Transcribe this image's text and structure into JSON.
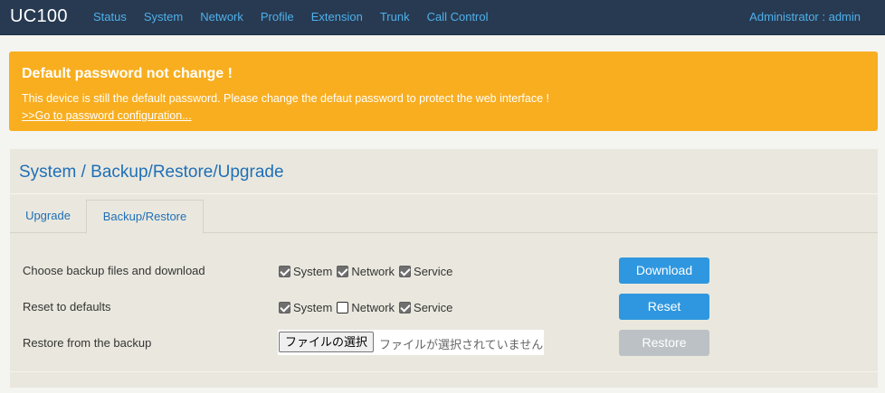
{
  "header": {
    "brand": "UC100",
    "nav": [
      "Status",
      "System",
      "Network",
      "Profile",
      "Extension",
      "Trunk",
      "Call Control"
    ],
    "user": "Administrator : admin"
  },
  "alert": {
    "title": "Default password not change !",
    "message": "This device is still the default password. Please change the defaut password to protect the web interface !",
    "link": ">>Go to password configuration..."
  },
  "page": {
    "title": "System / Backup/Restore/Upgrade",
    "tabs": [
      "Upgrade",
      "Backup/Restore"
    ],
    "active_tab": "Backup/Restore"
  },
  "rows": {
    "backup": {
      "label": "Choose backup files and download",
      "options": [
        {
          "label": "System",
          "checked": true
        },
        {
          "label": "Network",
          "checked": true
        },
        {
          "label": "Service",
          "checked": true
        }
      ],
      "button": "Download"
    },
    "reset": {
      "label": "Reset to defaults",
      "options": [
        {
          "label": "System",
          "checked": true
        },
        {
          "label": "Network",
          "checked": false
        },
        {
          "label": "Service",
          "checked": true
        }
      ],
      "button": "Reset"
    },
    "restore": {
      "label": "Restore from the backup",
      "file_button": "ファイルの選択",
      "file_status": "ファイルが選択されていません",
      "button": "Restore"
    }
  },
  "colors": {
    "topbar": "#273a52",
    "nav_link": "#4fb0ea",
    "alert": "#f8ae1f",
    "primary_button": "#2f97df",
    "disabled_button": "#bcc1c5",
    "title": "#1f6fb8"
  }
}
